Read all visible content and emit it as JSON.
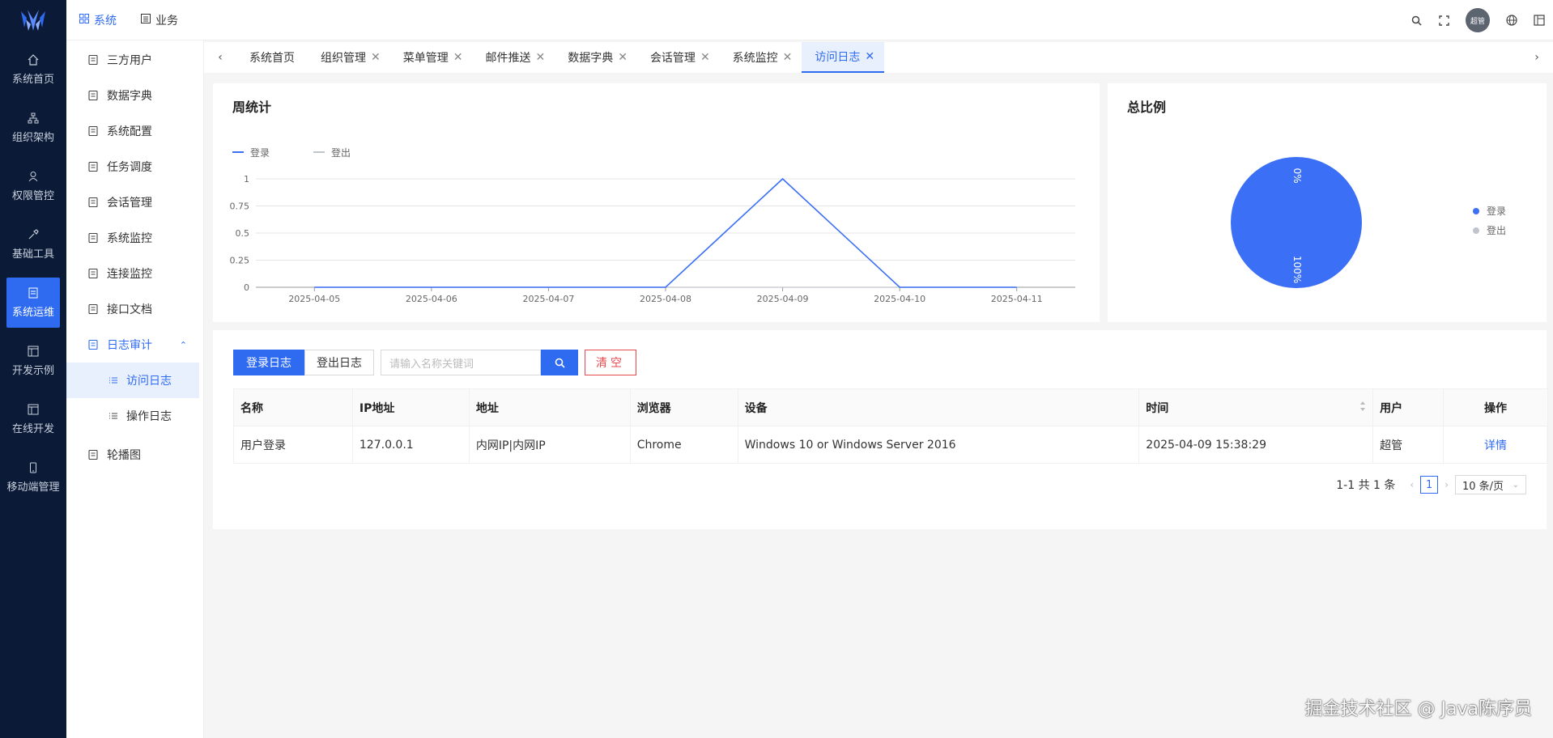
{
  "rail": {
    "items": [
      {
        "label": "系统首页",
        "icon": "home-icon"
      },
      {
        "label": "组织架构",
        "icon": "org-icon"
      },
      {
        "label": "权限管控",
        "icon": "user-icon"
      },
      {
        "label": "基础工具",
        "icon": "tool-icon"
      },
      {
        "label": "系统运维",
        "icon": "ops-icon",
        "active": true
      },
      {
        "label": "开发示例",
        "icon": "code-icon"
      },
      {
        "label": "在线开发",
        "icon": "online-dev-icon"
      },
      {
        "label": "移动端管理",
        "icon": "mobile-icon"
      }
    ]
  },
  "header": {
    "tabs": [
      {
        "label": "系统",
        "active": true
      },
      {
        "label": "业务"
      }
    ],
    "avatar_text": "超管"
  },
  "sidebar": {
    "items": [
      {
        "label": "三方用户"
      },
      {
        "label": "数据字典"
      },
      {
        "label": "系统配置"
      },
      {
        "label": "任务调度"
      },
      {
        "label": "会话管理"
      },
      {
        "label": "系统监控"
      },
      {
        "label": "连接监控"
      },
      {
        "label": "接口文档"
      },
      {
        "label": "日志审计"
      },
      {
        "label": "访问日志"
      },
      {
        "label": "操作日志"
      },
      {
        "label": "轮播图"
      }
    ]
  },
  "tabs": [
    {
      "label": "系统首页"
    },
    {
      "label": "组织管理"
    },
    {
      "label": "菜单管理"
    },
    {
      "label": "邮件推送"
    },
    {
      "label": "数据字典"
    },
    {
      "label": "会话管理"
    },
    {
      "label": "系统监控"
    },
    {
      "label": "访问日志",
      "active": true
    }
  ],
  "weekly": {
    "title": "周统计",
    "legend": [
      "登录",
      "登出"
    ]
  },
  "ratio": {
    "title": "总比例",
    "legend": [
      "登录",
      "登出"
    ],
    "label_top": "0%",
    "label_bottom": "100%"
  },
  "chart_data": [
    {
      "type": "line",
      "title": "周统计",
      "x": [
        "2025-04-05",
        "2025-04-06",
        "2025-04-07",
        "2025-04-08",
        "2025-04-09",
        "2025-04-10",
        "2025-04-11"
      ],
      "y_ticks": [
        "0",
        "0.25",
        "0.5",
        "0.75",
        "1"
      ],
      "ylim": [
        0,
        1
      ],
      "series": [
        {
          "name": "登录",
          "values": [
            0,
            0,
            0,
            0,
            1,
            0,
            0
          ],
          "color": "#3b6ff5"
        },
        {
          "name": "登出",
          "values": [
            0,
            0,
            0,
            0,
            0,
            0,
            0
          ],
          "color": "#c0c4cc"
        }
      ],
      "legend": "top-left",
      "grid": true
    },
    {
      "type": "pie",
      "title": "总比例",
      "slices": [
        {
          "name": "登录",
          "value": 100,
          "label": "100%",
          "color": "#3b6ff5"
        },
        {
          "name": "登出",
          "value": 0,
          "label": "0%",
          "color": "#c0c4cc"
        }
      ],
      "legend": "right"
    }
  ],
  "toolbar": {
    "login_log": "登录日志",
    "logout_log": "登出日志",
    "search_placeholder": "请输入名称关键词",
    "clear": "清空"
  },
  "table": {
    "headers": [
      "名称",
      "IP地址",
      "地址",
      "浏览器",
      "设备",
      "时间",
      "用户",
      "操作"
    ],
    "rows": [
      [
        "用户登录",
        "127.0.0.1",
        "内网IP|内网IP",
        "Chrome",
        "Windows 10 or Windows Server 2016",
        "2025-04-09 15:38:29",
        "超管",
        "详情"
      ]
    ]
  },
  "pager": {
    "summary": "1-1 共 1 条",
    "page": "1",
    "size": "10 条/页"
  },
  "watermark": "掘金技术社区 @ Java陈序员"
}
